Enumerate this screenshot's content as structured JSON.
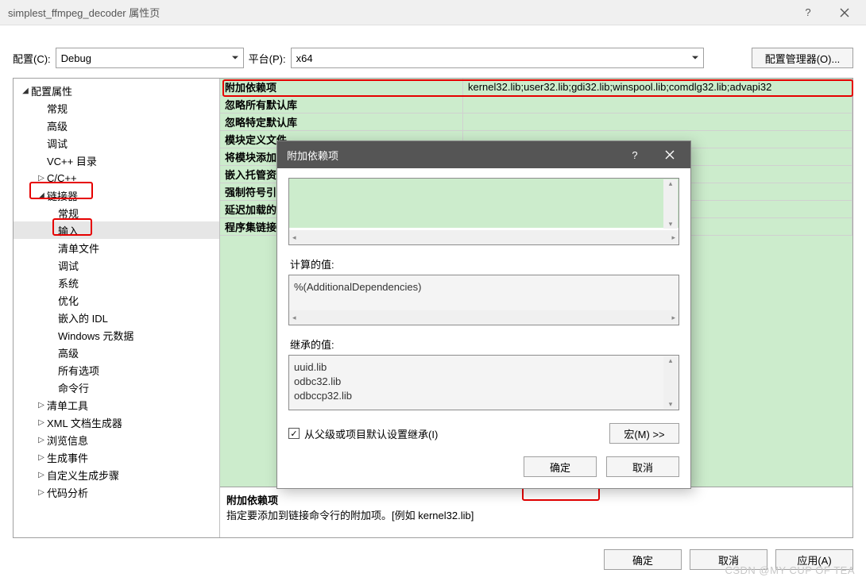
{
  "window": {
    "title": "simplest_ffmpeg_decoder 属性页"
  },
  "topbar": {
    "config_label": "配置(C):",
    "config_value": "Debug",
    "platform_label": "平台(P):",
    "platform_value": "x64",
    "manager_btn": "配置管理器(O)..."
  },
  "tree": {
    "root": "配置属性",
    "items_l1": [
      "常规",
      "高级",
      "调试",
      "VC++ 目录",
      "C/C++",
      "链接器"
    ],
    "linker_children": [
      "常规",
      "输入",
      "清单文件",
      "调试",
      "系统",
      "优化",
      "嵌入的 IDL",
      "Windows 元数据",
      "高级",
      "所有选项",
      "命令行"
    ],
    "items_after": [
      "清单工具",
      "XML 文档生成器",
      "浏览信息",
      "生成事件",
      "自定义生成步骤",
      "代码分析"
    ]
  },
  "grid": {
    "rows": [
      {
        "label": "附加依赖项",
        "value": "kernel32.lib;user32.lib;gdi32.lib;winspool.lib;comdlg32.lib;advapi32"
      },
      {
        "label": "忽略所有默认库",
        "value": ""
      },
      {
        "label": "忽略特定默认库",
        "value": ""
      },
      {
        "label": "模块定义文件",
        "value": ""
      },
      {
        "label": "将模块添加到程序集",
        "value": ""
      },
      {
        "label": "嵌入托管资源文件",
        "value": ""
      },
      {
        "label": "强制符号引用",
        "value": ""
      },
      {
        "label": "延迟加载的 DLL",
        "value": ""
      },
      {
        "label": "程序集链接资源",
        "value": ""
      }
    ],
    "footer_title": "附加依赖项",
    "footer_desc": "指定要添加到链接命令行的附加项。[例如 kernel32.lib]"
  },
  "modal": {
    "title": "附加依赖项",
    "computed_label": "计算的值:",
    "computed_value": "%(AdditionalDependencies)",
    "inherited_label": "继承的值:",
    "inherited_values": [
      "uuid.lib",
      "odbc32.lib",
      "odbccp32.lib"
    ],
    "inherit_checkbox": "从父级或项目默认设置继承(I)",
    "macro_btn": "宏(M) >>",
    "ok": "确定",
    "cancel": "取消"
  },
  "footer": {
    "ok": "确定",
    "cancel": "取消",
    "apply": "应用(A)"
  },
  "watermark": "CSDN @MY CUP OF TEA"
}
